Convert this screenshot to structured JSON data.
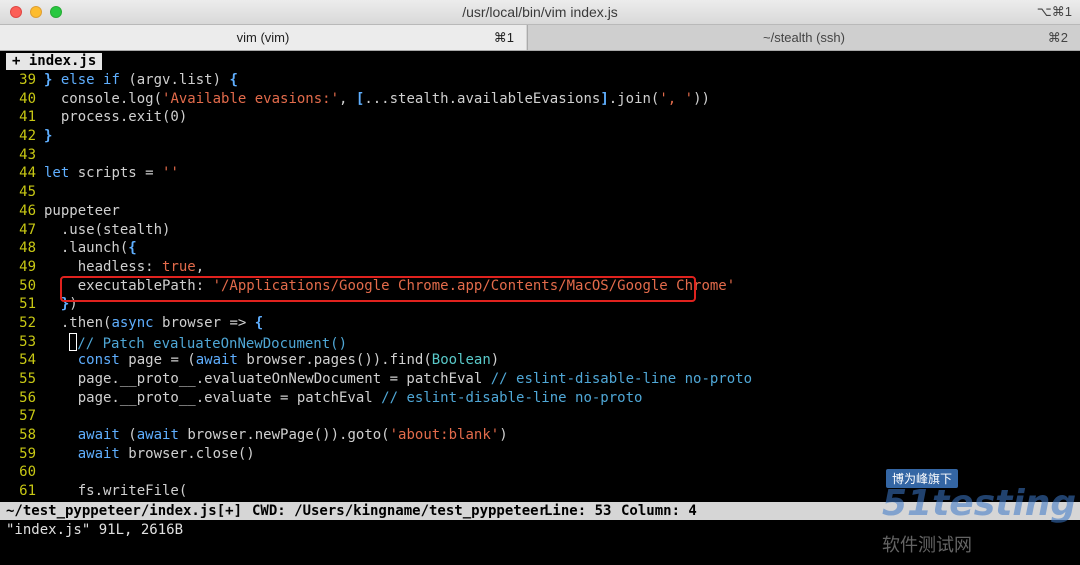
{
  "window": {
    "title": "/usr/local/bin/vim index.js",
    "shortcut": "⌥⌘1"
  },
  "tabs": [
    {
      "label": "vim (vim)",
      "key": "⌘1"
    },
    {
      "label": "~/stealth (ssh)",
      "key": "⌘2"
    }
  ],
  "vim_tab": {
    "label": "+ index.js"
  },
  "code_lines": [
    {
      "n": "39",
      "html": "<span class=\"br\">}</span> <span class=\"kw\">else if</span> (argv.list) <span class=\"br\">{</span>"
    },
    {
      "n": "40",
      "html": "  console.log(<span class=\"str\">'Available evasions:'</span>, <span class=\"br\">[</span>...stealth.availableEvasions<span class=\"br\">]</span>.join(<span class=\"str\">', '</span>))"
    },
    {
      "n": "41",
      "html": "  process.exit(0)"
    },
    {
      "n": "42",
      "html": "<span class=\"br\">}</span>"
    },
    {
      "n": "43",
      "html": ""
    },
    {
      "n": "44",
      "html": "<span class=\"kw\">let</span> scripts = <span class=\"str\">''</span>"
    },
    {
      "n": "45",
      "html": ""
    },
    {
      "n": "46",
      "html": "puppeteer"
    },
    {
      "n": "47",
      "html": "  .use(stealth)"
    },
    {
      "n": "48",
      "html": "  .launch(<span class=\"br\">{</span>"
    },
    {
      "n": "49",
      "html": "    headless: <span class=\"str\">true</span>,"
    },
    {
      "n": "50",
      "html": "    executablePath: <span class=\"str\">'/Applications/Google Chrome.app/Contents/MacOS/Google Chrome'</span>"
    },
    {
      "n": "51",
      "html": "  <span class=\"br\">}</span>)"
    },
    {
      "n": "52",
      "html": "  .then(<span class=\"kw\">async</span> browser =&gt; <span class=\"br\">{</span>"
    },
    {
      "n": "53",
      "html": "   <span class=\"cursor\"></span><span class=\"cmt\">// Patch evaluateOnNewDocument()</span>"
    },
    {
      "n": "54",
      "html": "    <span class=\"kw\">const</span> page = (<span class=\"kw\">await</span> browser.pages()).find(<span class=\"fn\">Boolean</span>)"
    },
    {
      "n": "55",
      "html": "    page.__proto__.evaluateOnNewDocument = patchEval <span class=\"cmt\">// eslint-disable-line no-proto</span>"
    },
    {
      "n": "56",
      "html": "    page.__proto__.evaluate = patchEval <span class=\"cmt\">// eslint-disable-line no-proto</span>"
    },
    {
      "n": "57",
      "html": ""
    },
    {
      "n": "58",
      "html": "    <span class=\"kw\">await</span> (<span class=\"kw\">await</span> browser.newPage()).goto(<span class=\"str\">'about:blank'</span>)"
    },
    {
      "n": "59",
      "html": "    <span class=\"kw\">await</span> browser.close()"
    },
    {
      "n": "60",
      "html": ""
    },
    {
      "n": "61",
      "html": "    fs.writeFile("
    }
  ],
  "status": {
    "file": "~/test_pyppeteer/index.js[+]",
    "cwd": "CWD: /Users/kingname/test_pyppeteer",
    "line": "Line: 53",
    "column": "Column: 4"
  },
  "cmdline": "\"index.js\" 91L, 2616B",
  "watermark": {
    "badge": "博为峰旗下",
    "brand": "51testing",
    "sub": "软件测试网"
  }
}
